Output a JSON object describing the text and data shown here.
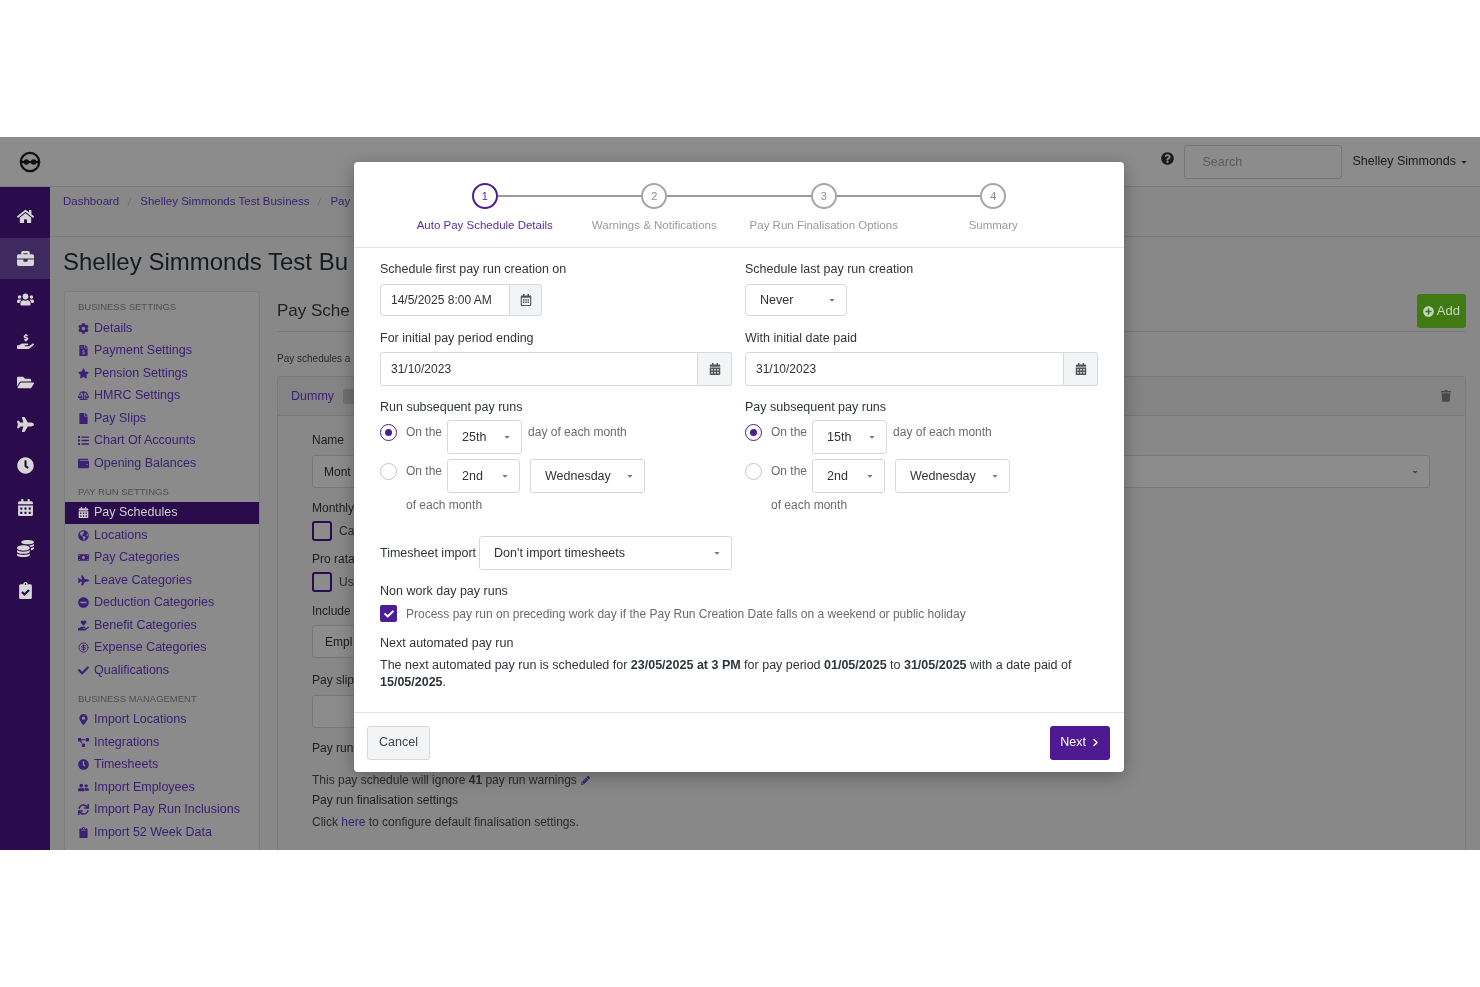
{
  "top_bar": {
    "search": {
      "placeholder": "Search"
    },
    "user_menu": "Shelley Simmonds"
  },
  "nav_rail": [
    {
      "selected": false
    },
    {
      "selected": true
    },
    {
      "selected": false
    },
    {
      "selected": false
    },
    {
      "selected": false
    },
    {
      "selected": false
    },
    {
      "selected": false
    },
    {
      "selected": false
    },
    {
      "selected": false
    },
    {
      "selected": false
    }
  ],
  "breadcrumb": [
    "Dashboard",
    "Shelley Simmonds Test Business",
    "Pay"
  ],
  "page_title": "Shelley Simmonds Test Bu",
  "settings_nav": [
    {
      "heading": "BUSINESS SETTINGS",
      "items": [
        {
          "label": "Details",
          "selected": false
        },
        {
          "label": "Payment Settings",
          "selected": false
        },
        {
          "label": "Pension Settings",
          "selected": false
        },
        {
          "label": "HMRC Settings",
          "selected": false
        },
        {
          "label": "Pay Slips",
          "selected": false
        },
        {
          "label": "Chart Of Accounts",
          "selected": false
        },
        {
          "label": "Opening Balances",
          "selected": false
        }
      ]
    },
    {
      "heading": "PAY RUN SETTINGS",
      "items": [
        {
          "label": "Pay Schedules",
          "selected": true
        },
        {
          "label": "Locations",
          "selected": false
        },
        {
          "label": "Pay Categories",
          "selected": false
        },
        {
          "label": "Leave Categories",
          "selected": false
        },
        {
          "label": "Deduction Categories",
          "selected": false
        },
        {
          "label": "Benefit Categories",
          "selected": false
        },
        {
          "label": "Expense Categories",
          "selected": false
        },
        {
          "label": "Qualifications",
          "selected": false
        }
      ]
    },
    {
      "heading": "BUSINESS MANAGEMENT",
      "items": [
        {
          "label": "Import Locations",
          "selected": false
        },
        {
          "label": "Integrations",
          "selected": false
        },
        {
          "label": "Timesheets",
          "selected": false
        },
        {
          "label": "Import Employees",
          "selected": false
        },
        {
          "label": "Import Pay Run Inclusions",
          "selected": false
        },
        {
          "label": "Import 52 Week Data",
          "selected": false
        }
      ]
    }
  ],
  "pay_schedules": {
    "heading": "Pay Sche",
    "add_button": "Add",
    "intro": "Pay schedules a",
    "tab": "Dummy",
    "name": {
      "label": "Name",
      "value": "Mont"
    },
    "monthly": {
      "label": "Monthly",
      "option": "Ca",
      "checked": false
    },
    "pro_rata": {
      "label": "Pro rata",
      "option": "Us",
      "checked": false
    },
    "included": {
      "label": "Include",
      "value": "Empl"
    },
    "pay_slip": {
      "label": "Pay slip"
    },
    "pay_run": {
      "label": "Pay run",
      "note": "This pay schedule will ignore **41** pay run warnings"
    },
    "finalisation": {
      "label": "Pay run finalisation settings",
      "note_before": "Click",
      "link": "here",
      "note_after": "to configure default finalisation settings."
    }
  },
  "dialog": {
    "steps": [
      {
        "number": "1",
        "label": "Auto Pay Schedule Details",
        "selected": true
      },
      {
        "number": "2",
        "label": "Warnings & Notifications",
        "selected": false
      },
      {
        "number": "3",
        "label": "Pay Run Finalisation Options",
        "selected": false
      },
      {
        "number": "4",
        "label": "Summary",
        "selected": false
      }
    ],
    "first_run": {
      "label": "Schedule first pay run creation on",
      "value": "14/5/2025 8:00 AM"
    },
    "last_run": {
      "label": "Schedule last pay run creation",
      "value": "Never"
    },
    "period_ending": {
      "label": "For initial pay period ending",
      "value": "31/10/2023"
    },
    "date_paid": {
      "label": "With initial date paid",
      "value": "31/10/2023"
    },
    "run_subsequent": {
      "label": "Run subsequent pay runs",
      "options": [
        {
          "kind": "day",
          "selected": true,
          "prefix": "On the",
          "day": "25th",
          "suffix": "day of each month"
        },
        {
          "kind": "weekday",
          "selected": false,
          "prefix": "On the",
          "ordinal": "2nd",
          "weekday": "Wednesday",
          "suffix": "of each month"
        }
      ]
    },
    "pay_subsequent": {
      "label": "Pay subsequent pay runs",
      "options": [
        {
          "kind": "day",
          "selected": true,
          "prefix": "On the",
          "day": "15th",
          "suffix": "day of each month"
        },
        {
          "kind": "weekday",
          "selected": false,
          "prefix": "On the",
          "ordinal": "2nd",
          "weekday": "Wednesday",
          "suffix": "of each month"
        }
      ]
    },
    "timesheet_import": {
      "label": "Timesheet import",
      "value": "Don't import timesheets"
    },
    "non_work_day": {
      "label": "Non work day pay runs",
      "option": "Process pay run on preceding work day if the Pay Run Creation Date falls on a weekend or public holiday",
      "checked": true
    },
    "next_run": {
      "label": "Next automated pay run",
      "text": "The next automated pay run is scheduled for **23/05/2025 at 3 PM** for pay period **01/05/2025** to **31/05/2025** with a date paid of **15/05/2025**."
    },
    "buttons": {
      "cancel": "Cancel",
      "next": "Next"
    }
  }
}
